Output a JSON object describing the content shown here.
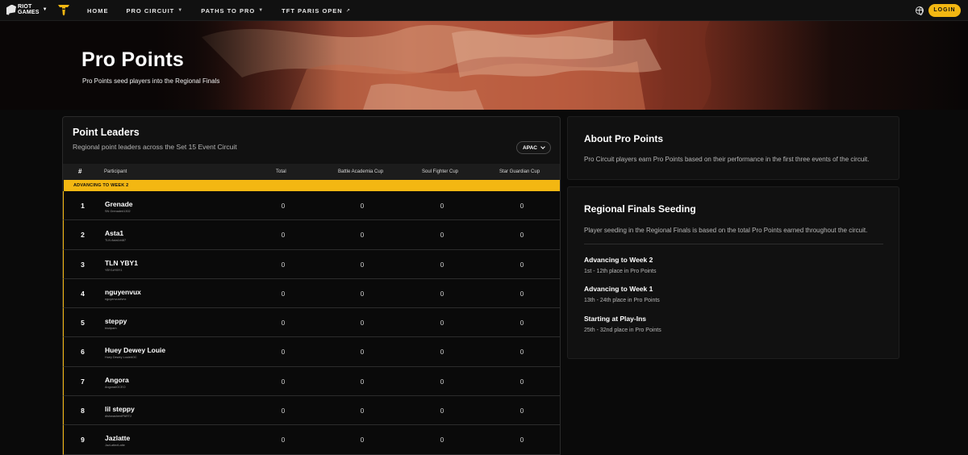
{
  "nav": {
    "brand_line1": "RIOT",
    "brand_line2": "GAMES",
    "items": [
      {
        "label": "HOME",
        "has_caret": false
      },
      {
        "label": "PRO CIRCUIT",
        "has_caret": true
      },
      {
        "label": "PATHS TO PRO",
        "has_caret": true
      },
      {
        "label": "TFT PARIS OPEN",
        "external": true
      }
    ],
    "caret_glyph": "▼",
    "external_glyph": "↗",
    "login_label": "LOGIN",
    "icons": [
      "riot-games-logo",
      "tft-logo",
      "globe-icon"
    ]
  },
  "hero": {
    "title": "Pro Points",
    "subtitle": "Pro Points seed players into the Regional Finals"
  },
  "leaders": {
    "title": "Point Leaders",
    "subtitle": "Regional point leaders across the Set 15 Event Circuit",
    "region": "APAC",
    "columns": {
      "rank": "#",
      "participant": "Participant",
      "total": "Total",
      "cup1": "Battle Academia Cup",
      "cup2": "Soul Fighter Cup",
      "cup3": "Star Guardian Cup"
    },
    "advancing_label": "ADVANCING TO WEEK 2",
    "rows": [
      {
        "rank": "1",
        "name": "Grenade",
        "tag": "SN Grenade#1302",
        "total": "0",
        "cup1": "0",
        "cup2": "0",
        "cup3": "0"
      },
      {
        "rank": "2",
        "name": "Asta1",
        "tag": "TLN Asta1#487",
        "total": "0",
        "cup1": "0",
        "cup2": "0",
        "cup3": "0"
      },
      {
        "rank": "3",
        "name": "TLN YBY1",
        "tag": "YBY1#YBY1",
        "total": "0",
        "cup1": "0",
        "cup2": "0",
        "cup3": "0"
      },
      {
        "rank": "4",
        "name": "nguyenvux",
        "tag": "nguyenvux#vnx",
        "total": "0",
        "cup1": "0",
        "cup2": "0",
        "cup3": "0"
      },
      {
        "rank": "5",
        "name": "steppy",
        "tag": "blu#pam",
        "total": "0",
        "cup1": "0",
        "cup2": "0",
        "cup3": "0"
      },
      {
        "rank": "6",
        "name": "Huey Dewey Louie",
        "tag": "Huey Dewey Louie#OC",
        "total": "0",
        "cup1": "0",
        "cup2": "0",
        "cup3": "0"
      },
      {
        "rank": "7",
        "name": "Angora",
        "tag": "Angora#OCEO",
        "total": "0",
        "cup1": "0",
        "cup2": "0",
        "cup3": "0"
      },
      {
        "rank": "8",
        "name": "lil steppy",
        "tag": "dishwasher#PART2",
        "total": "0",
        "cup1": "0",
        "cup2": "0",
        "cup3": "0"
      },
      {
        "rank": "9",
        "name": "Jazlatte",
        "tag": "JazLatte#Latte",
        "total": "0",
        "cup1": "0",
        "cup2": "0",
        "cup3": "0"
      }
    ]
  },
  "about": {
    "title": "About Pro Points",
    "text": "Pro Circuit players earn Pro Points based on their performance in the first three events of the circuit."
  },
  "seeding": {
    "title": "Regional Finals Seeding",
    "text": "Player seeding in the Regional Finals is based on the total Pro Points earned throughout the circuit.",
    "tiers": [
      {
        "title": "Advancing to Week 2",
        "desc": "1st - 12th place in Pro Points"
      },
      {
        "title": "Advancing to Week 1",
        "desc": "13th - 24th place in Pro Points"
      },
      {
        "title": "Starting at Play-Ins",
        "desc": "25th - 32nd place in Pro Points"
      }
    ]
  },
  "colors": {
    "accent": "#f3b712",
    "background": "#0a0a0a",
    "panel": "#111111",
    "hero_primary": "#b6523a"
  }
}
